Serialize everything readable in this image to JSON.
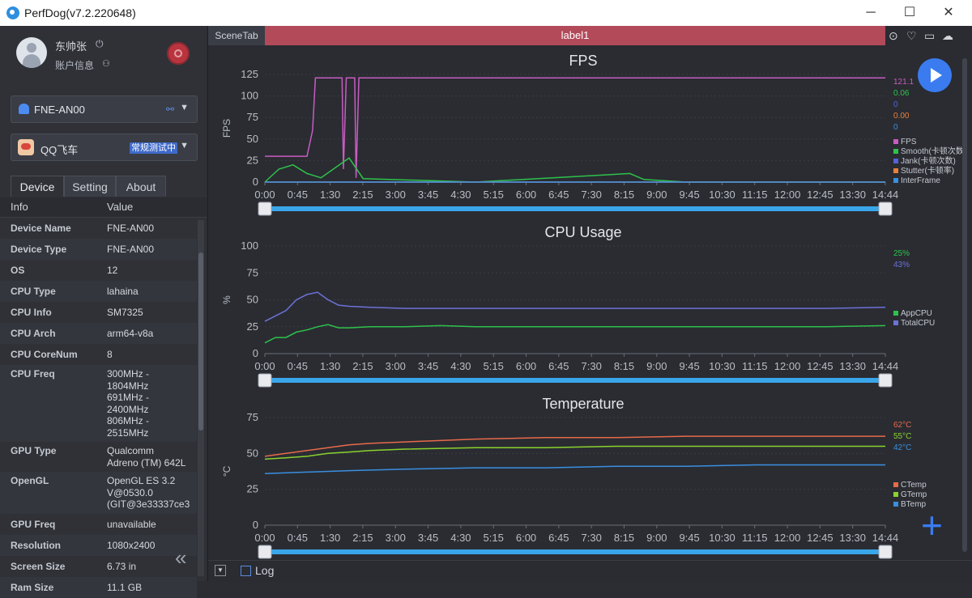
{
  "window": {
    "title": "PerfDog(v7.2.220648)",
    "minimize": "─",
    "maximize": "☐",
    "close": "✕"
  },
  "user": {
    "name": "东帅张",
    "account_label": "账户信息",
    "power_glyph": "⏻",
    "account_glyph": "👤"
  },
  "device_select": {
    "value": "FNE-AN00",
    "caret": "▼",
    "link_glyph": "🔗"
  },
  "app_select": {
    "value": "QQ飞车",
    "badge": "常规测试中",
    "caret": "▼"
  },
  "tabs": [
    "Device",
    "Setting",
    "About"
  ],
  "info": {
    "header": [
      "Info",
      "Value"
    ],
    "rows": [
      {
        "k": "Device Name",
        "v": [
          "FNE-AN00"
        ]
      },
      {
        "k": "Device Type",
        "v": [
          "FNE-AN00"
        ]
      },
      {
        "k": "OS",
        "v": [
          "12"
        ]
      },
      {
        "k": "CPU Type",
        "v": [
          "lahaina"
        ]
      },
      {
        "k": "CPU Info",
        "v": [
          "SM7325"
        ]
      },
      {
        "k": "CPU Arch",
        "v": [
          "arm64-v8a"
        ]
      },
      {
        "k": "CPU CoreNum",
        "v": [
          "8"
        ]
      },
      {
        "k": "CPU Freq",
        "v": [
          "300MHz -",
          "1804MHz",
          "691MHz -",
          "2400MHz",
          "806MHz -",
          "2515MHz"
        ]
      },
      {
        "k": "GPU Type",
        "v": [
          "Qualcomm",
          "Adreno (TM) 642L"
        ]
      },
      {
        "k": "OpenGL",
        "v": [
          "OpenGL ES 3.2",
          "V@0530.0",
          "(GIT@3e33337ce3"
        ]
      },
      {
        "k": "GPU Freq",
        "v": [
          "unavailable"
        ]
      },
      {
        "k": "Resolution",
        "v": [
          "1080x2400"
        ]
      },
      {
        "k": "Screen Size",
        "v": [
          "6.73 in"
        ]
      },
      {
        "k": "Ram Size",
        "v": [
          "11.1 GB"
        ]
      }
    ],
    "collapse_glyph": "«"
  },
  "scene": {
    "tab": "SceneTab",
    "label": "label1",
    "icons": [
      "⊙",
      "♡",
      "▭",
      "☁"
    ]
  },
  "log": {
    "label": "Log",
    "toggle_glyph": "▼"
  },
  "plus_glyph": "+",
  "colors": {
    "fps": "#c85cc0",
    "smooth": "#2ec24a",
    "jank": "#5563d8",
    "stutter": "#e8803a",
    "interframe": "#3a8fe0",
    "appcpu": "#2ec24a",
    "totalcpu": "#6c72d8",
    "ctemp": "#e86a4a",
    "gtemp": "#8ad22e",
    "btemp": "#3a8fe0"
  },
  "x_ticks": [
    "0:00",
    "0:45",
    "1:30",
    "2:15",
    "3:00",
    "3:45",
    "4:30",
    "5:15",
    "6:00",
    "6:45",
    "7:30",
    "8:15",
    "9:00",
    "9:45",
    "10:30",
    "11:15",
    "12:00",
    "12:45",
    "13:30",
    "14:44"
  ],
  "chart_data": [
    {
      "type": "line",
      "title": "FPS",
      "ylabel": "FPS",
      "ylim": [
        0,
        125
      ],
      "yticks": [
        0,
        25,
        50,
        75,
        100,
        125
      ],
      "x_range_seconds": [
        0,
        884
      ],
      "series": [
        {
          "name": "FPS",
          "current": "121.1",
          "points": [
            [
              0,
              30
            ],
            [
              60,
              30
            ],
            [
              68,
              60
            ],
            [
              72,
              121
            ],
            [
              110,
              121
            ],
            [
              112,
              15
            ],
            [
              116,
              121
            ],
            [
              128,
              121
            ],
            [
              130,
              5
            ],
            [
              134,
              121
            ],
            [
              500,
              121
            ],
            [
              520,
              121
            ],
            [
              700,
              121
            ],
            [
              884,
              121
            ]
          ]
        },
        {
          "name": "Smooth(卡顿次数)",
          "current": "0.06",
          "points": [
            [
              0,
              0
            ],
            [
              20,
              15
            ],
            [
              40,
              20
            ],
            [
              60,
              10
            ],
            [
              80,
              5
            ],
            [
              120,
              28
            ],
            [
              140,
              4
            ],
            [
              300,
              0
            ],
            [
              520,
              10
            ],
            [
              540,
              3
            ],
            [
              600,
              0
            ],
            [
              884,
              0
            ]
          ]
        },
        {
          "name": "Jank(卡顿次数)",
          "current": "0",
          "points": [
            [
              0,
              0
            ],
            [
              884,
              0
            ]
          ]
        },
        {
          "name": "Stutter(卡顿率)",
          "current": "0.00",
          "points": [
            [
              0,
              0
            ],
            [
              884,
              0
            ]
          ]
        },
        {
          "name": "InterFrame",
          "current": "0",
          "points": [
            [
              0,
              0
            ],
            [
              884,
              0
            ]
          ]
        }
      ]
    },
    {
      "type": "line",
      "title": "CPU Usage",
      "ylabel": "%",
      "ylim": [
        0,
        100
      ],
      "yticks": [
        0,
        25,
        50,
        75,
        100
      ],
      "x_range_seconds": [
        0,
        884
      ],
      "series": [
        {
          "name": "AppCPU",
          "current": "25%",
          "points": [
            [
              0,
              10
            ],
            [
              15,
              15
            ],
            [
              30,
              15
            ],
            [
              45,
              20
            ],
            [
              60,
              22
            ],
            [
              75,
              25
            ],
            [
              90,
              27
            ],
            [
              105,
              24
            ],
            [
              120,
              24
            ],
            [
              150,
              25
            ],
            [
              200,
              25
            ],
            [
              250,
              26
            ],
            [
              300,
              25
            ],
            [
              400,
              25
            ],
            [
              500,
              25
            ],
            [
              600,
              25
            ],
            [
              700,
              25
            ],
            [
              800,
              25
            ],
            [
              884,
              26
            ]
          ]
        },
        {
          "name": "TotalCPU",
          "current": "43%",
          "points": [
            [
              0,
              30
            ],
            [
              15,
              35
            ],
            [
              30,
              40
            ],
            [
              45,
              50
            ],
            [
              60,
              55
            ],
            [
              75,
              57
            ],
            [
              90,
              50
            ],
            [
              105,
              45
            ],
            [
              120,
              44
            ],
            [
              150,
              43
            ],
            [
              200,
              42
            ],
            [
              250,
              42
            ],
            [
              300,
              42
            ],
            [
              350,
              42
            ],
            [
              400,
              42
            ],
            [
              500,
              42
            ],
            [
              600,
              42
            ],
            [
              700,
              42
            ],
            [
              800,
              42
            ],
            [
              884,
              43
            ]
          ]
        }
      ]
    },
    {
      "type": "line",
      "title": "Temperature",
      "ylabel": "°C",
      "ylim": [
        0,
        75
      ],
      "yticks": [
        0,
        25,
        50,
        75
      ],
      "x_range_seconds": [
        0,
        884
      ],
      "series": [
        {
          "name": "CTemp",
          "current": "62°C",
          "points": [
            [
              0,
              48
            ],
            [
              30,
              50
            ],
            [
              60,
              52
            ],
            [
              90,
              54
            ],
            [
              120,
              56
            ],
            [
              150,
              57
            ],
            [
              200,
              58
            ],
            [
              250,
              59
            ],
            [
              300,
              60
            ],
            [
              400,
              61
            ],
            [
              500,
              61
            ],
            [
              600,
              62
            ],
            [
              700,
              62
            ],
            [
              800,
              62
            ],
            [
              884,
              62
            ]
          ]
        },
        {
          "name": "GTemp",
          "current": "55°C",
          "points": [
            [
              0,
              46
            ],
            [
              30,
              47
            ],
            [
              60,
              48
            ],
            [
              90,
              50
            ],
            [
              120,
              51
            ],
            [
              150,
              52
            ],
            [
              200,
              53
            ],
            [
              300,
              54
            ],
            [
              400,
              54
            ],
            [
              500,
              55
            ],
            [
              600,
              55
            ],
            [
              700,
              55
            ],
            [
              800,
              55
            ],
            [
              884,
              55
            ]
          ]
        },
        {
          "name": "BTemp",
          "current": "42°C",
          "points": [
            [
              0,
              36
            ],
            [
              60,
              37
            ],
            [
              120,
              38
            ],
            [
              200,
              39
            ],
            [
              300,
              40
            ],
            [
              400,
              40
            ],
            [
              500,
              41
            ],
            [
              600,
              41
            ],
            [
              700,
              42
            ],
            [
              884,
              42
            ]
          ]
        }
      ]
    }
  ]
}
